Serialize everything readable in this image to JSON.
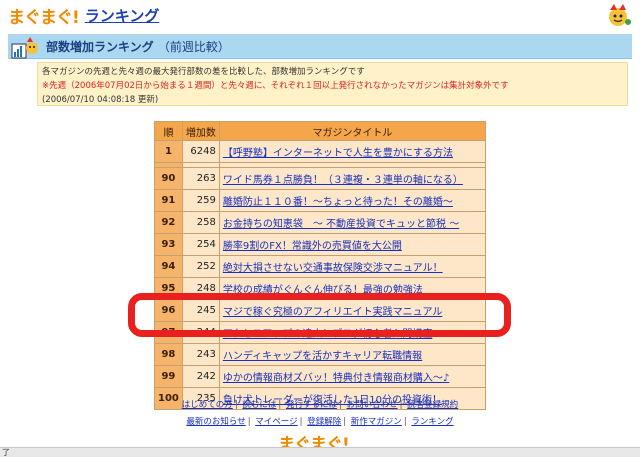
{
  "header": {
    "logo_text": "まぐまぐ!",
    "title": "ランキング"
  },
  "banner": {
    "title": "部数増加ランキング",
    "subtitle": "（前週比較）"
  },
  "info": {
    "line1": "各マガジンの先週と先々週の最大発行部数の差を比較した、部数増加ランキングです",
    "line2": "※先週（2006年07月02日から始まる１週間）と先々週に、それぞれ１回以上発行されなかったマガジンは集計対象外です",
    "line3": "(2006/07/10 04:08:18 更新)"
  },
  "table": {
    "headers": [
      "順",
      "増加数",
      "マガジンタイトル"
    ],
    "rows": [
      {
        "rank": "1",
        "increase": "6248",
        "title": "【呼野塾】インターネットで人生を豊かにする方法"
      },
      {
        "rank": "90",
        "increase": "263",
        "title": "ワイド馬券１点勝負！（３連複・３連単の軸になる）"
      },
      {
        "rank": "91",
        "increase": "259",
        "title": "離婚防止１１０番！〜ちょっと待った！その離婚〜"
      },
      {
        "rank": "92",
        "increase": "258",
        "title": "お金持ちの知恵袋　〜 不動産投資でキュッと節税 〜"
      },
      {
        "rank": "93",
        "increase": "254",
        "title": "勝率9割のFX！常識外の売買値を大公開"
      },
      {
        "rank": "94",
        "increase": "252",
        "title": "絶対大損させない交通事故保険交渉マニュアル！"
      },
      {
        "rank": "95",
        "increase": "248",
        "title": "学校の成績がぐんぐん伸びる！最強の勉強法"
      },
      {
        "rank": "96",
        "increase": "245",
        "title": "マジで稼ぐ究極のアフィリエイト実践マニュアル"
      },
      {
        "rank": "97",
        "increase": "244",
        "title": "アクセスアップの達人！ブログ初心者入門講座"
      },
      {
        "rank": "98",
        "increase": "243",
        "title": "ハンディキャップを活かすキャリア転職情報"
      },
      {
        "rank": "99",
        "increase": "242",
        "title": "ゆかの情報商材ズバッ！特典付き情報商材購入〜♪"
      },
      {
        "rank": "100",
        "increase": "235",
        "title": "負け犬トレーダーが復活した1日10分の投資術！"
      }
    ]
  },
  "footer": {
    "row1": [
      "はじめての方",
      "読むには",
      "発行するには",
      "お問い合わせ",
      "読者登録規約"
    ],
    "row2": [
      "最新のお知らせ",
      "マイページ",
      "登録解除",
      "新作マガジン",
      "ランキング"
    ],
    "logo_text": "まぐまぐ!"
  },
  "statusbar": {
    "text": "了"
  },
  "colors": {
    "highlight": "#e8201e",
    "banner": "#a9d8f0",
    "table_header": "#f5a54a",
    "link": "#1830c0"
  }
}
